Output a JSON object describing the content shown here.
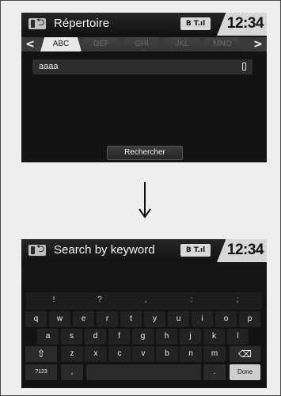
{
  "screen1": {
    "title": "Répertoire",
    "clock": "12:34",
    "status_indicator": "B  T.ıl",
    "tabs": [
      "ABC",
      "DEF",
      "GHI",
      "JKL",
      "MNO"
    ],
    "active_tab_index": 0,
    "contact": "aaaa",
    "search_button": "Rechercher",
    "icons": {
      "phone": "phone-icon",
      "back": "back-arrow-icon",
      "left": "chevron-left-icon",
      "right": "chevron-right-icon",
      "mobile": "mobile-phone-icon"
    }
  },
  "arrow_symbol": "down-arrow",
  "screen2": {
    "title": "Search by keyword",
    "clock": "12:34",
    "status_indicator": "B  T.ıl",
    "symbols": [
      "!",
      "?",
      ",",
      ":",
      ";"
    ],
    "row1": [
      "q",
      "w",
      "e",
      "r",
      "t",
      "y",
      "u",
      "i",
      "o",
      "p"
    ],
    "row2": [
      "a",
      "s",
      "d",
      "f",
      "g",
      "h",
      "j",
      "k",
      "l"
    ],
    "row3": [
      "z",
      "x",
      "c",
      "v",
      "b",
      "n",
      "m"
    ],
    "shift_label": "⇧",
    "backspace_label": "⌫",
    "mode_label": "?123",
    "comma_label": ",",
    "period_label": ".",
    "done_label": "Done"
  }
}
